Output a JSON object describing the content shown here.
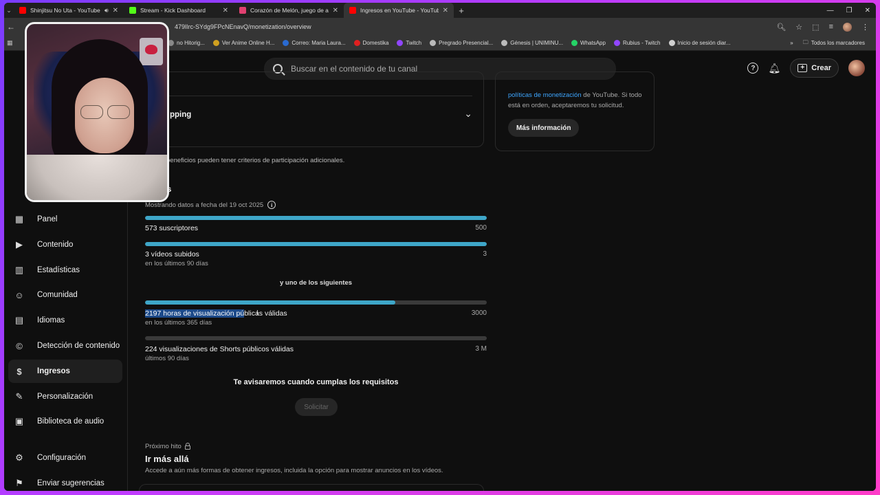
{
  "browser": {
    "tabs": [
      {
        "title": "Shinjitsu No Uta - YouTube",
        "favicon_color": "#ff0000",
        "active": false,
        "audio": true
      },
      {
        "title": "Stream - Kick Dashboard",
        "favicon_color": "#53fc18",
        "active": false,
        "audio": false
      },
      {
        "title": "Corazón de Melón, juego de ar",
        "favicon_color": "#e04070",
        "active": false,
        "audio": false
      },
      {
        "title": "Ingresos en YouTube - YouTube",
        "favicon_color": "#ff0000",
        "active": true,
        "audio": false
      }
    ],
    "url": "479lIrc-SYdg9FPcNEnavQ/monetization/overview",
    "bookmarks": [
      {
        "label": "no Hitorig...",
        "color": "#888888"
      },
      {
        "label": "Ver Anime Online H...",
        "color": "#d0a020"
      },
      {
        "label": "Correo: Maria Laura...",
        "color": "#2a6ad0"
      },
      {
        "label": "Domestika",
        "color": "#e02020"
      },
      {
        "label": "Twitch",
        "color": "#9146ff"
      },
      {
        "label": "Pregrado Presencial...",
        "color": "#bbbbbb"
      },
      {
        "label": "Génesis | UNIMINU...",
        "color": "#bbbbbb"
      },
      {
        "label": "WhatsApp",
        "color": "#25d366"
      },
      {
        "label": "Rubius - Twitch",
        "color": "#9146ff"
      },
      {
        "label": "Inicio de sesión diar...",
        "color": "#d0d0d0"
      }
    ],
    "all_bookmarks": "Todos los marcadores"
  },
  "header": {
    "search_placeholder": "Buscar en el contenido de tu canal",
    "create_label": "Crear"
  },
  "sidebar": {
    "items": [
      {
        "label": "Panel",
        "icon": "dashboard-icon",
        "glyph": "▦",
        "active": false
      },
      {
        "label": "Contenido",
        "icon": "content-icon",
        "glyph": "▶",
        "active": false
      },
      {
        "label": "Estadísticas",
        "icon": "analytics-icon",
        "glyph": "▥",
        "active": false
      },
      {
        "label": "Comunidad",
        "icon": "community-icon",
        "glyph": "☺",
        "active": false
      },
      {
        "label": "Idiomas",
        "icon": "languages-icon",
        "glyph": "▤",
        "active": false
      },
      {
        "label": "Detección de contenido",
        "icon": "copyright-icon",
        "glyph": "©",
        "active": false
      },
      {
        "label": "Ingresos",
        "icon": "dollar-icon",
        "glyph": "$",
        "active": true
      },
      {
        "label": "Personalización",
        "icon": "customization-icon",
        "glyph": "✎",
        "active": false
      },
      {
        "label": "Biblioteca de audio",
        "icon": "audio-library-icon",
        "glyph": "▣",
        "active": false
      },
      {
        "label": "Configuración",
        "icon": "settings-icon",
        "glyph": "⚙",
        "active": false
      },
      {
        "label": "Enviar sugerencias",
        "icon": "feedback-icon",
        "glyph": "⚑",
        "active": false
      }
    ]
  },
  "main": {
    "shopping_title": "pping",
    "benefits_note": "beneficios pueden tener criterios de participación adicionales.",
    "requirements_title": "tos",
    "data_date": "Mostrando datos a fecha del 19 oct 2025",
    "requirements": [
      {
        "label": "573 suscriptores",
        "sub": "",
        "target": "500",
        "progress": 1.0
      },
      {
        "label": "3 vídeos subidos",
        "sub": "en los últimos 90 días",
        "target": "3",
        "progress": 1.0
      }
    ],
    "or_one_of": "y uno de los siguientes",
    "alternatives": [
      {
        "label_selected": "2197 horas de visualización pú",
        "label_rest": "blicas válidas",
        "sub": "en los últimos 365 días",
        "target": "3000",
        "progress": 0.7323
      },
      {
        "label_selected": "",
        "label_rest": "224 visualizaciones de Shorts públicos válidas",
        "sub": "últimos 90 días",
        "target": "3 M",
        "progress": 0.0
      }
    ],
    "notify_text": "Te avisaremos cuando cumplas los requisitos",
    "apply_button": "Solicitar",
    "next_milestone_label": "Próximo hito",
    "next_milestone_title": "Ir más allá",
    "next_milestone_desc": "Accede a aún más formas de obtener ingresos, incluida la opción para mostrar anuncios en los vídeos."
  },
  "right_card": {
    "link_text": "políticas de monetización",
    "text_after_link": " de YouTube. Si todo",
    "text_line2": "está en orden, aceptaremos tu solicitud.",
    "button": "Más información"
  },
  "colors": {
    "accent_progress": "#3ea6c8",
    "link": "#3ea6ff",
    "selection": "#1c4a8a"
  }
}
